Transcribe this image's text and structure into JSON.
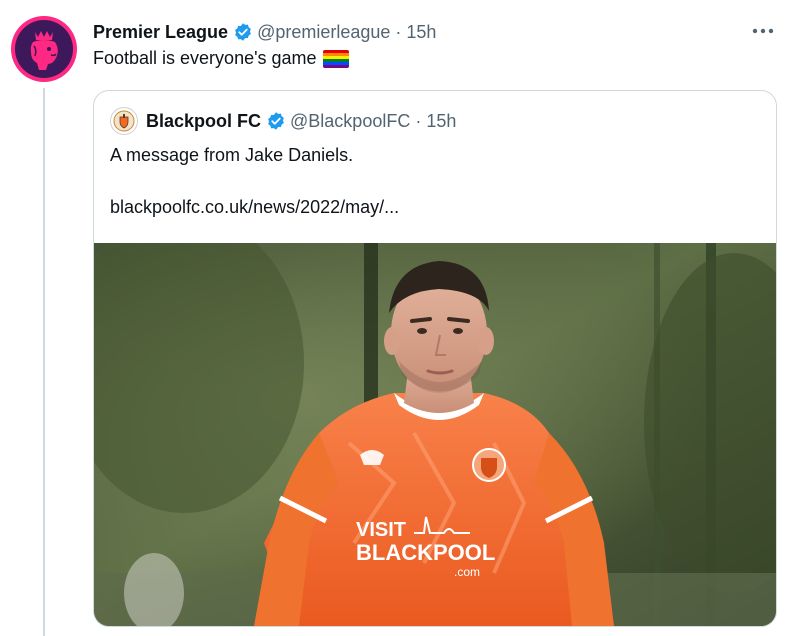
{
  "tweet": {
    "author_name": "Premier League",
    "author_handle": "@premierleague",
    "separator": "·",
    "time": "15h",
    "text": "Football is everyone's game",
    "emoji": "rainbow-flag",
    "more_icon": "more-horizontal-icon"
  },
  "quoted": {
    "author_name": "Blackpool FC",
    "author_handle": "@BlackpoolFC",
    "separator": "·",
    "time": "15h",
    "text": "A message from Jake Daniels.",
    "link": "blackpoolfc.co.uk/news/2022/may/...",
    "image": {
      "subject": "Footballer in orange Blackpool kit",
      "shirt_sponsor_line1": "VISIT",
      "shirt_sponsor_line2": "BLACKPOOL",
      "shirt_sponsor_line3": ".com"
    }
  },
  "colors": {
    "verified": "#1d9bf0",
    "secondary_text": "#536471",
    "pl_pink": "#ff2882",
    "pl_purple": "#3d195b",
    "blackpool_orange": "#f26a21"
  }
}
